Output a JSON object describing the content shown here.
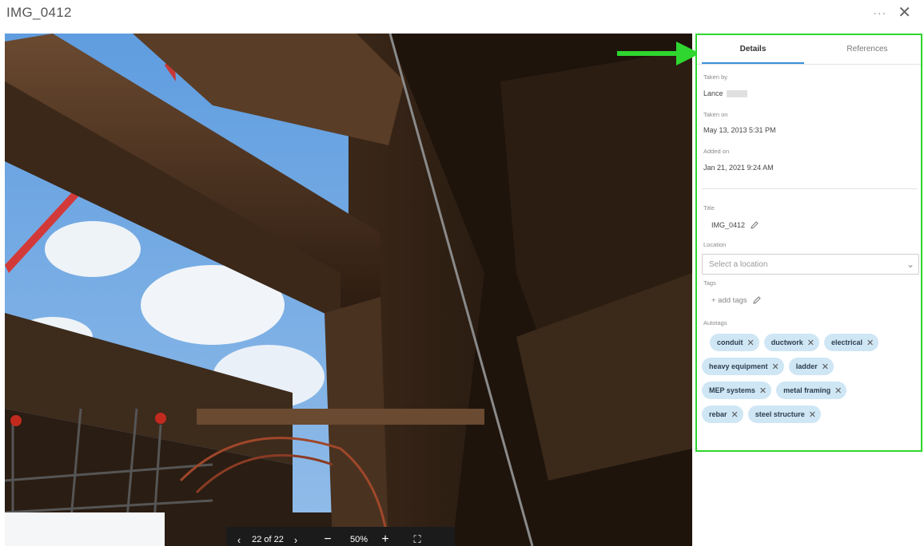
{
  "header": {
    "title": "IMG_0412",
    "more_glyph": "···",
    "close_glyph": "✕"
  },
  "viewer": {
    "prev_glyph": "‹",
    "counter": "22 of 22",
    "next_glyph": "›",
    "minus_glyph": "−",
    "zoom": "50%",
    "plus_glyph": "+",
    "fullscreen_glyph": "⛶"
  },
  "panel": {
    "tabs": {
      "details": "Details",
      "references": "References"
    },
    "taken_by": {
      "label": "Taken by",
      "value": "Lance"
    },
    "taken_on": {
      "label": "Taken on",
      "value": "May 13, 2013 5:31 PM"
    },
    "added_on": {
      "label": "Added on",
      "value": "Jan 21, 2021 9:24 AM"
    },
    "title": {
      "label": "Title",
      "value": "IMG_0412"
    },
    "location": {
      "label": "Location",
      "placeholder": "Select a location"
    },
    "tags": {
      "label": "Tags",
      "add_text": "+ add tags"
    },
    "autotags": {
      "label": "Autotags",
      "rows": [
        [
          "conduit",
          "ductwork",
          "electrical"
        ],
        [
          "heavy equipment",
          "ladder"
        ],
        [
          "MEP systems",
          "metal framing"
        ],
        [
          "rebar",
          "steel structure"
        ]
      ]
    }
  },
  "colors": {
    "highlight": "#2fd62f",
    "tab_accent": "#3a8fd8",
    "chip_bg": "#cfe6f5"
  }
}
